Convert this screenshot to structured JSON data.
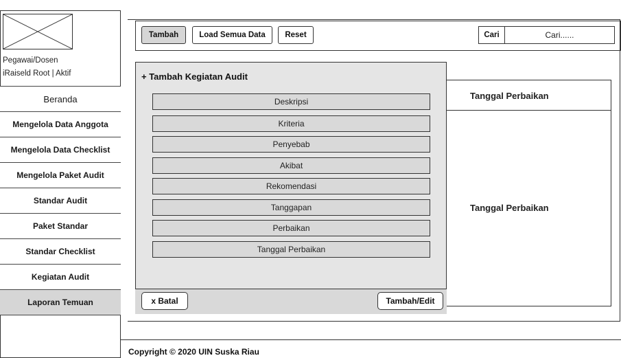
{
  "sidebar": {
    "user_role": "Pegawai/Dosen",
    "user_status": "iRaiseld Root  |  Aktif",
    "items": [
      {
        "label": "Beranda"
      },
      {
        "label": "Mengelola Data Anggota"
      },
      {
        "label": "Mengelola Data Checklist"
      },
      {
        "label": "Mengelola Paket Audit"
      },
      {
        "label": "Standar Audit"
      },
      {
        "label": "Paket Standar"
      },
      {
        "label": "Standar Checklist"
      },
      {
        "label": "Kegiatan Audit"
      },
      {
        "label": "Laporan Temuan",
        "active": true
      }
    ]
  },
  "toolbar": {
    "add_label": "Tambah",
    "load_label": "Load Semua Data",
    "reset_label": "Reset",
    "search_label": "Cari",
    "search_placeholder": "Cari......"
  },
  "dialog": {
    "title": "+ Tambah Kegiatan Audit",
    "fields": [
      "Deskripsi",
      "Kriteria",
      "Penyebab",
      "Akibat",
      "Rekomendasi",
      "Tanggapan",
      "Perbaikan",
      "Tanggal Perbaikan"
    ],
    "cancel_label": "x Batal",
    "submit_label": "Tambah/Edit"
  },
  "right_panel": {
    "header": "Tanggal Perbaikan",
    "value": "Tanggal Perbaikan"
  },
  "footer": {
    "copyright": "Copyright © 2020 UIN Suska Riau"
  },
  "icons": {
    "logo": "image-placeholder-icon"
  }
}
